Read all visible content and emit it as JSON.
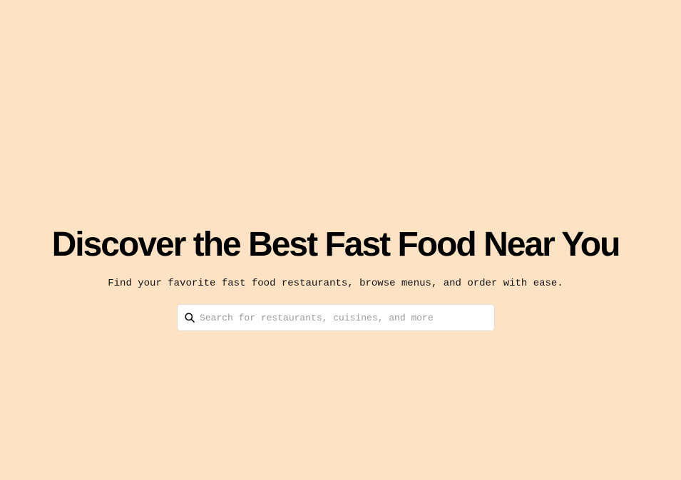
{
  "hero": {
    "title": "Discover the Best Fast Food Near You",
    "subtitle": "Find your favorite fast food restaurants, browse menus, and order with ease."
  },
  "search": {
    "placeholder": "Search for restaurants, cuisines, and more",
    "value": "",
    "icon": "search-icon"
  },
  "colors": {
    "background": "#fde3c4",
    "title": "#000000",
    "search_background": "#ffffff"
  }
}
